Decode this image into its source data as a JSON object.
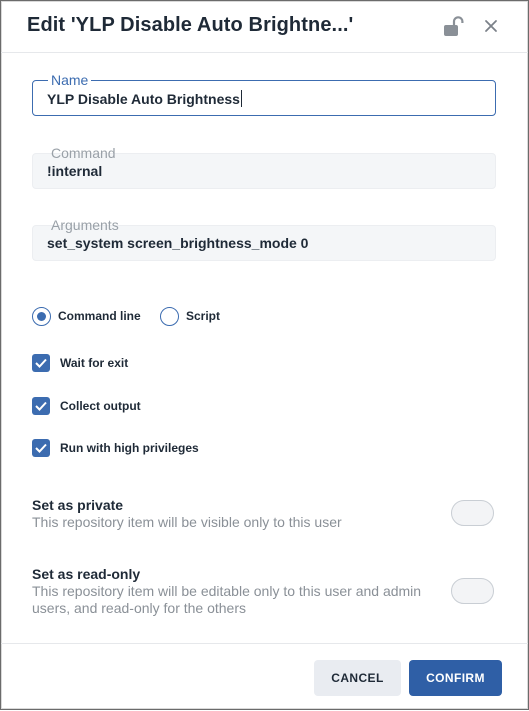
{
  "dialog": {
    "title": "Edit 'YLP Disable Auto Brightne...'"
  },
  "header": {
    "lock_icon": "unlock-icon",
    "close_icon": "close-icon"
  },
  "fields": {
    "name": {
      "label": "Name",
      "value": "YLP Disable Auto Brightness"
    },
    "command": {
      "label": "Command",
      "value": "!internal"
    },
    "arguments": {
      "label": "Arguments",
      "value": "set_system screen_brightness_mode 0"
    }
  },
  "mode": {
    "options": [
      {
        "label": "Command line",
        "selected": true
      },
      {
        "label": "Script",
        "selected": false
      }
    ]
  },
  "checkboxes": [
    {
      "label": "Wait for exit",
      "checked": true
    },
    {
      "label": "Collect output",
      "checked": true
    },
    {
      "label": "Run with high privileges",
      "checked": true
    }
  ],
  "settings": {
    "private": {
      "title": "Set as private",
      "description": "This repository item will be visible only to this user",
      "enabled": false
    },
    "readonly": {
      "title": "Set as read-only",
      "description": "This repository item will be editable only to this user and admin users, and read-only for the others",
      "enabled": false
    }
  },
  "footer": {
    "cancel_label": "CANCEL",
    "confirm_label": "CONFIRM"
  },
  "colors": {
    "accent": "#3c6cb0",
    "confirm_bg": "#2f5fa6",
    "cancel_bg": "#e9ecf1"
  }
}
